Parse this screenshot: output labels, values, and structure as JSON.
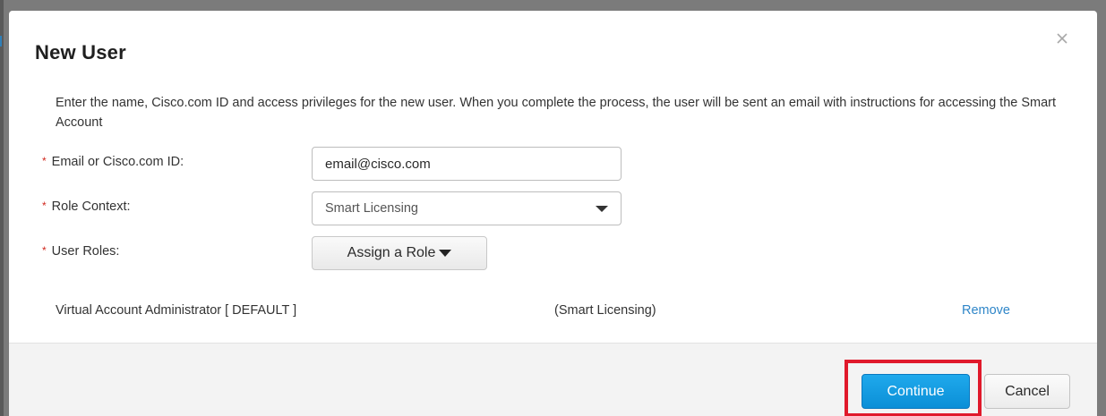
{
  "modal": {
    "title": "New User",
    "close_icon": "close-icon",
    "intro_text": "Enter the name, Cisco.com ID and access privileges for the new user. When you complete the process, the user will be sent an email with instructions for accessing the Smart Account"
  },
  "form": {
    "required_marker": "*",
    "email": {
      "label": "Email or Cisco.com ID:",
      "value": "email@cisco.com"
    },
    "role_context": {
      "label": "Role Context:",
      "selected": "Smart Licensing"
    },
    "user_roles": {
      "label": "User Roles:",
      "button_label": "Assign a Role"
    }
  },
  "assigned_role": {
    "name": "Virtual Account Administrator [ DEFAULT ]",
    "context": "(Smart Licensing)",
    "remove_label": "Remove"
  },
  "footer": {
    "continue_label": "Continue",
    "cancel_label": "Cancel"
  },
  "colors": {
    "primary_button": "#1a9fe4",
    "link": "#2f86c8",
    "required": "#d0271d",
    "highlight": "#e0192b"
  }
}
